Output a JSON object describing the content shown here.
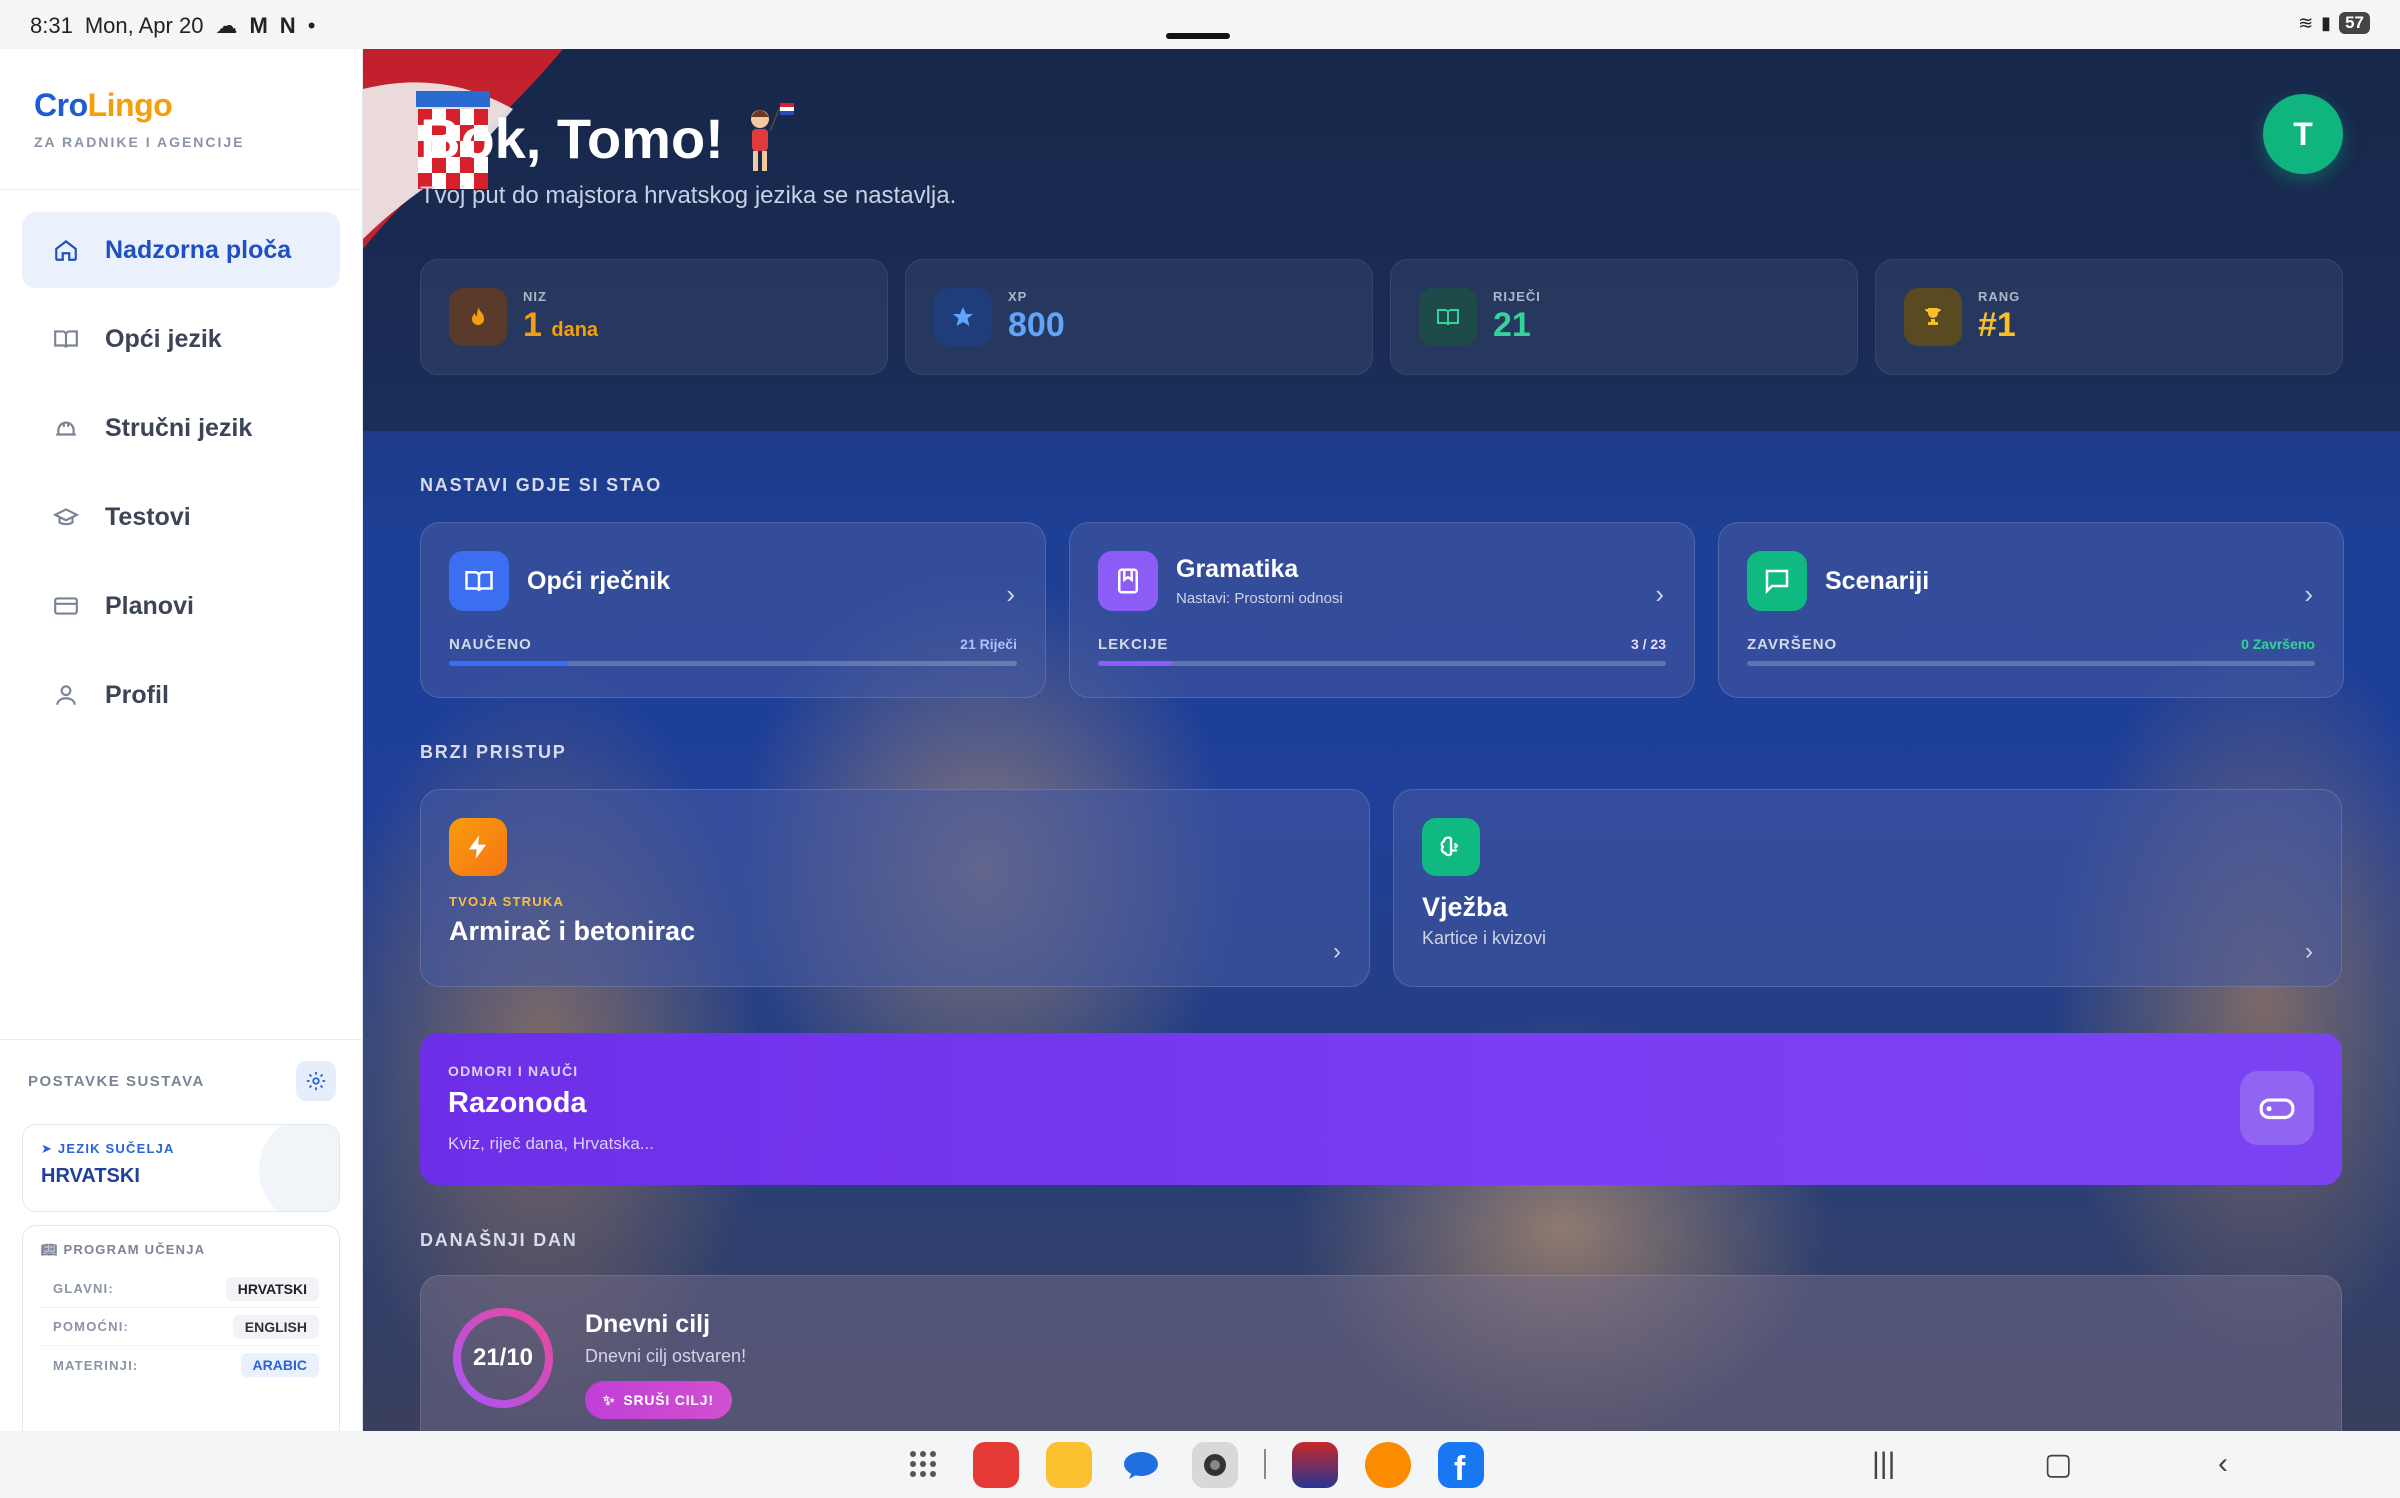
{
  "status": {
    "time": "8:31",
    "date": "Mon, Apr 20",
    "battery": "57"
  },
  "brand": {
    "cro": "Cro",
    "lingo": "Lingo",
    "subtitle": "ZA RADNIKE I AGENCIJE"
  },
  "nav": [
    {
      "label": "Nadzorna ploča",
      "icon": "home-icon",
      "active": true
    },
    {
      "label": "Opći jezik",
      "icon": "book-icon"
    },
    {
      "label": "Stručni jezik",
      "icon": "helmet-icon"
    },
    {
      "label": "Testovi",
      "icon": "graduation-cap-icon"
    },
    {
      "label": "Planovi",
      "icon": "card-icon"
    },
    {
      "label": "Profil",
      "icon": "user-icon"
    }
  ],
  "settings": {
    "title": "POSTAVKE SUSTAVA",
    "interface_label": "JEZIK SUČELJA",
    "interface_value": "HRVATSKI",
    "program_label": "PROGRAM UČENJA",
    "rows": [
      {
        "key": "GLAVNI:",
        "value": "HRVATSKI"
      },
      {
        "key": "POMOĆNI:",
        "value": "ENGLISH"
      },
      {
        "key": "MATERINJI:",
        "value": "ARABIC"
      }
    ]
  },
  "hero": {
    "greeting": "Bok, Tomo!",
    "subtitle": "Tvoj put do majstora hrvatskog jezika se nastavlja.",
    "avatar": "T"
  },
  "stats": [
    {
      "label": "NIZ",
      "value": "1",
      "unit": "dana",
      "color": "#f59e0b",
      "icon": "flame-icon"
    },
    {
      "label": "XP",
      "value": "800",
      "unit": "",
      "color": "#60a5fa",
      "icon": "star-icon"
    },
    {
      "label": "RIJEČI",
      "value": "21",
      "unit": "",
      "color": "#34d399",
      "icon": "book-icon"
    },
    {
      "label": "RANG",
      "value": "#1",
      "unit": "",
      "color": "#fbbf24",
      "icon": "trophy-icon"
    }
  ],
  "continue": {
    "title": "NASTAVI GDJE SI STAO",
    "cards": [
      {
        "title": "Opći rječnik",
        "subtitle": "",
        "foot_label": "NAUČENO",
        "foot_value": "21 Riječi",
        "progress": 0.21,
        "accent": "#3b6ef0",
        "value_color": "#a9c4ff"
      },
      {
        "title": "Gramatika",
        "subtitle": "Nastavi: Prostorni odnosi",
        "foot_label": "LEKCIJE",
        "foot_value": "3 / 23",
        "progress": 0.13,
        "accent": "#8b5cf6",
        "value_color": "#e9ddff"
      },
      {
        "title": "Scenariji",
        "subtitle": "",
        "foot_label": "ZAVRŠENO",
        "foot_value": "0 Završeno",
        "progress": 0,
        "accent": "#10b981",
        "value_color": "#34d399"
      }
    ]
  },
  "quick": {
    "title": "BRZI PRISTUP",
    "trade_eyebrow": "TVOJA STRUKA",
    "trade_title": "Armirač i betonirac",
    "practice_title": "Vježba",
    "practice_subtitle": "Kartice i kvizovi"
  },
  "fun": {
    "eyebrow": "ODMORI I NAUČI",
    "title": "Razonoda",
    "subtitle": "Kviz, riječ dana, Hrvatska..."
  },
  "today": {
    "title": "DANAŠNJI DAN",
    "goal_ring": "21/10",
    "goal_progress": 1,
    "goal_title": "Dnevni cilj",
    "goal_subtitle": "Dnevni cilj ostvaren!",
    "goal_button": "SRUŠI CILJ!"
  }
}
